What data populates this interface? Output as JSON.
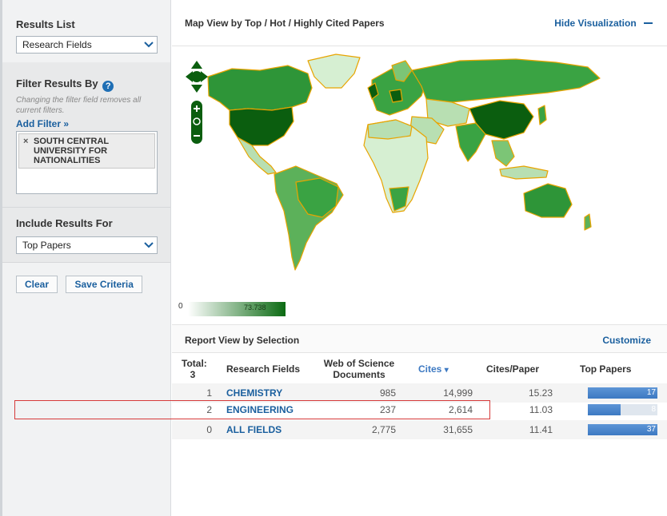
{
  "sidebar": {
    "results_list_label": "Results List",
    "results_list_value": "Research Fields",
    "filter_title": "Filter Results By",
    "filter_help": "?",
    "filter_hint": "Changing the filter field removes all current filters.",
    "add_filter": "Add Filter »",
    "filter_chip_remove": "×",
    "filter_chip": "SOUTH CENTRAL UNIVERSITY FOR NATIONALITIES",
    "include_label": "Include Results For",
    "include_value": "Top Papers",
    "clear_button": "Clear",
    "save_button": "Save Criteria"
  },
  "map": {
    "title": "Map View by Top / Hot / Highly Cited Papers",
    "hide_label": "Hide Visualization",
    "legend_min": "0",
    "legend_max": "73.738"
  },
  "report": {
    "title": "Report View by Selection",
    "customize": "Customize",
    "headers": {
      "total": "Total:",
      "total_count": "3",
      "field": "Research Fields",
      "wos": "Web of Science Documents",
      "cites": "Cites",
      "cites_sort_icon": "▾",
      "cites_per_paper": "Cites/Paper",
      "top_papers": "Top Papers"
    },
    "rows": [
      {
        "index": "1",
        "field": "CHEMISTRY",
        "wos": "985",
        "cites": "14,999",
        "cpp": "15.23",
        "top": "17",
        "top_fraction": 1.0
      },
      {
        "index": "2",
        "field": "ENGINEERING",
        "wos": "237",
        "cites": "2,614",
        "cpp": "11.03",
        "top": "8",
        "top_fraction": 0.47
      },
      {
        "index": "0",
        "field": "ALL FIELDS",
        "wos": "2,775",
        "cites": "31,655",
        "cpp": "11.41",
        "top": "37",
        "top_fraction": 1.0
      }
    ]
  },
  "colors": {
    "accent": "#1a5f9e",
    "map_dark": "#0b5e0f",
    "map_mid": "#3aa343",
    "map_light": "#b8dfb2",
    "border": "#e8a400",
    "bar": "#3d79c2",
    "highlight": "#d63a3a"
  }
}
